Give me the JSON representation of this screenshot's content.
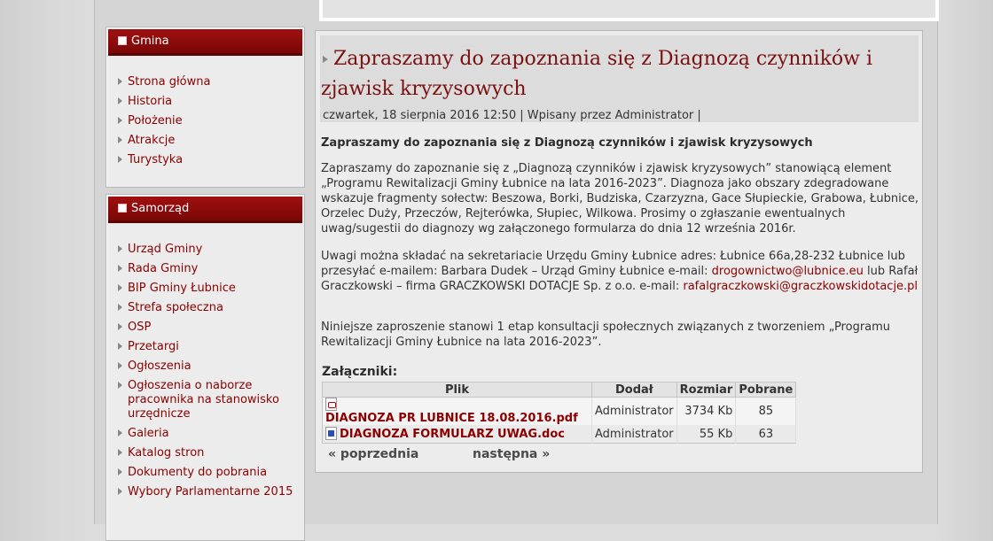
{
  "sidebar": {
    "blocks": [
      {
        "title": "Gmina",
        "items": [
          "Strona główna",
          "Historia",
          "Położenie",
          "Atrakcje",
          "Turystyka"
        ]
      },
      {
        "title": "Samorząd",
        "items": [
          "Urząd Gminy",
          "Rada Gminy",
          "BIP Gminy Łubnice",
          "Strefa społeczna",
          "OSP",
          "Przetargi",
          "Ogłoszenia",
          "Ogłoszenia o naborze pracownika na stanowisko urzędnicze",
          "Galeria",
          "Katalog stron",
          "Dokumenty do pobrania",
          "Wybory Parlamentarne 2015"
        ]
      }
    ]
  },
  "article": {
    "title": "Zapraszamy do zapoznania się z Diagnozą czynników i zjawisk kryzysowych",
    "meta": "czwartek, 18 sierpnia 2016 12:50 | Wpisany przez Administrator |",
    "lead": "Zapraszamy do zapoznania się z Diagnozą czynników i zjawisk kryzysowych",
    "p1": "Zapraszamy do zapoznanie się z „Diagnozą czynników i zjawisk kryzysowych” stanowiącą element „Programu Rewitalizacji Gminy Łubnice na lata 2016-2023”.  Diagnoza jako obszary zdegradowane wskazuje fragmenty sołectw: Beszowa, Borki, Budziska, Czarzyzna, Gace Słupieckie, Grabowa, Łubnice, Orzelec Duży, Przeczów, Rejterówka, Słupiec, Wilkowa. Prosimy o zgłaszanie ewentualnych uwag/sugestii do diagnozy wg załączonego formularza do dnia 12 września 2016r.",
    "p2_a": "Uwagi można składać na sekretariacie Urzędu Gminy Łubnice adres: Łubnice 66a,28-232 Łubnice lub przesyłać e-mailem: Barbara Dudek – Urząd Gminy Łubnice e-mail: ",
    "p2_link1": "drogownictwo@lubnice.eu",
    "p2_b": " lub Rafał Graczkowski – firma GRACZKOWSKI DOTACJE Sp. z o.o. e-mail: ",
    "p2_link2": "rafalgraczkowski@graczkowskidotacje.pl",
    "p3": "Niniejsze zaproszenie stanowi 1 etap konsultacji społecznych związanych z tworzeniem „Programu Rewitalizacji Gminy Łubnice na lata 2016-2023”."
  },
  "attachments": {
    "title": "Załączniki:",
    "headers": [
      "Plik",
      "Dodał",
      "Rozmiar",
      "Pobrane"
    ],
    "rows": [
      {
        "icon": "pdf-file-icon",
        "file": "DIAGNOZA PR LUBNICE 18.08.2016.pdf",
        "added_by": "Administrator",
        "size": "3734 Kb",
        "downloads": "85"
      },
      {
        "icon": "doc-file-icon",
        "file": "DIAGNOZA FORMULARZ UWAG.doc",
        "added_by": "Administrator",
        "size": "55 Kb",
        "downloads": "63"
      }
    ]
  },
  "pager": {
    "prev": "« poprzednia",
    "next": "następna »"
  }
}
